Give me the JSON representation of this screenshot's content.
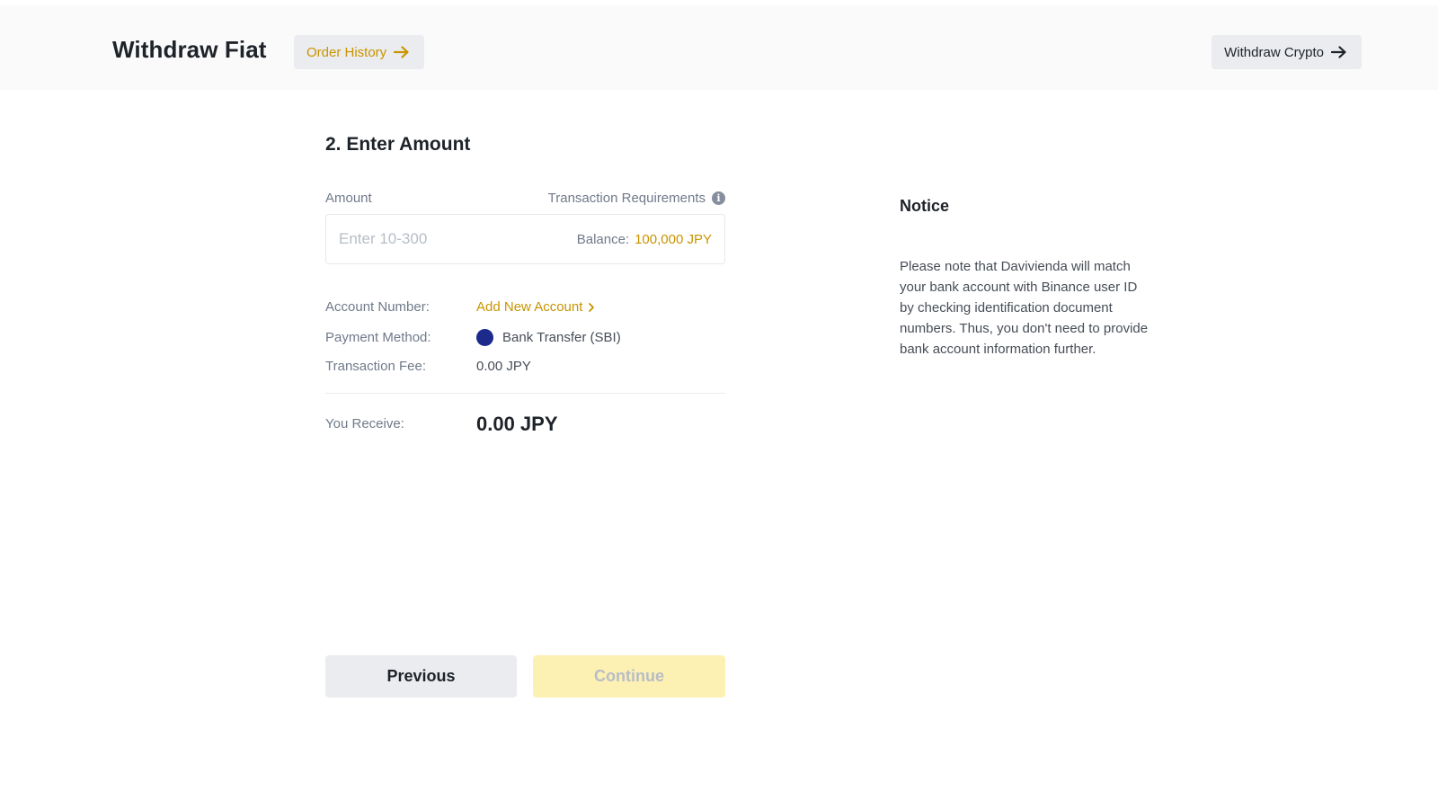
{
  "header": {
    "title": "Withdraw Fiat",
    "order_history_label": "Order History",
    "withdraw_crypto_label": "Withdraw Crypto"
  },
  "step": {
    "title": "2. Enter Amount"
  },
  "amount": {
    "label": "Amount",
    "requirements_label": "Transaction Requirements",
    "placeholder": "Enter 10-300",
    "value": "",
    "balance_label": "Balance:",
    "balance_value": "100,000 JPY"
  },
  "details": {
    "account_number_label": "Account Number:",
    "add_account_label": "Add New Account",
    "payment_method_label": "Payment Method:",
    "payment_method_value": "Bank Transfer (SBI)",
    "transaction_fee_label": "Transaction Fee:",
    "transaction_fee_value": "0.00 JPY"
  },
  "receive": {
    "label": "You Receive:",
    "value": "0.00 JPY"
  },
  "buttons": {
    "previous": "Previous",
    "continue": "Continue"
  },
  "notice": {
    "title": "Notice",
    "text": "Please note that Davivienda will match your bank account with Binance user ID by checking identification document numbers. Thus, you don't need to provide bank account information further."
  },
  "icons": {
    "order_history": "arrow-right-icon",
    "withdraw_crypto": "arrow-right-icon",
    "requirements": "info-icon",
    "add_account": "chevron-right-icon",
    "payment_method": "bank-logo-icon"
  },
  "colors": {
    "accent": "#c99400",
    "continue_disabled_bg": "#fdf0b3",
    "bank_logo": "#1c2a8c"
  }
}
